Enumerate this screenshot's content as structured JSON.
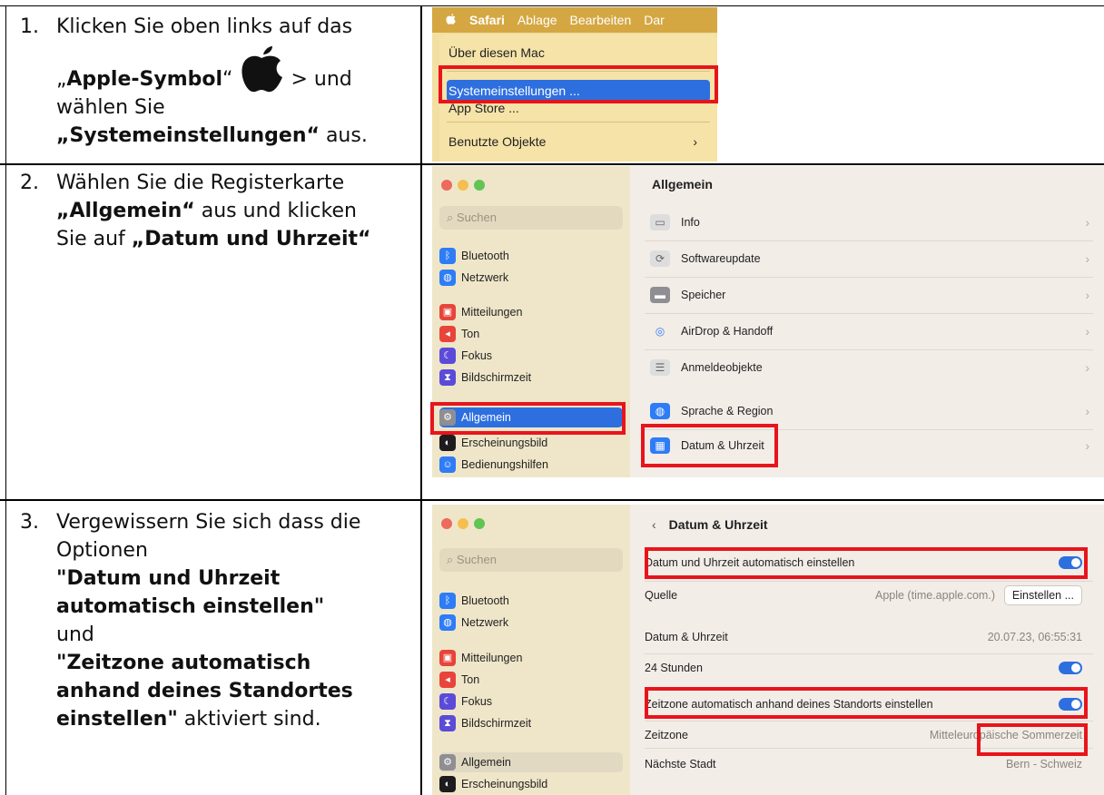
{
  "steps": [
    {
      "num": "1.",
      "line1": "Klicken Sie oben links auf das",
      "quote_open": "„",
      "bold1": "Apple-Symbol",
      "quote_close": "“",
      "after_icon": " > und",
      "line3": "wählen Sie",
      "bold2": "„Systemeinstellungen“",
      "line4_tail": " aus."
    },
    {
      "num": "2.",
      "line1": "Wählen Sie die Registerkarte",
      "bold1": "„Allgemein“",
      "line2_tail": " aus und klicken",
      "line3_head": "Sie auf ",
      "bold2": "„Datum und Uhrzeit“"
    },
    {
      "num": "3.",
      "line1": "Vergewissern Sie sich dass die",
      "line2": "Optionen",
      "bold1a": "\"Datum und Uhrzeit",
      "bold1b": "automatisch einstellen\"",
      "line5": "und",
      "bold2a": "\"Zeitzone automatisch",
      "bold2b": "anhand deines Standortes",
      "bold2c": "einstellen\"",
      "tail": " aktiviert sind."
    }
  ],
  "menu": {
    "bar": {
      "app": "Safari",
      "items": [
        "Ablage",
        "Bearbeiten",
        "Dar"
      ]
    },
    "items": [
      "Über diesen Mac",
      "Systemeinstellungen ...",
      "App Store ...",
      "Benutzte Objekte"
    ],
    "arrow": "›"
  },
  "sidebar": {
    "search_placeholder": "Suchen",
    "items": [
      "Bluetooth",
      "Netzwerk",
      "Mitteilungen",
      "Ton",
      "Fokus",
      "Bildschirmzeit",
      "Allgemein",
      "Erscheinungsbild",
      "Bedienungshilfen"
    ]
  },
  "general": {
    "title": "Allgemein",
    "rows": [
      "Info",
      "Softwareupdate",
      "Speicher",
      "AirDrop & Handoff",
      "Anmeldeobjekte",
      "Sprache & Region",
      "Datum & Uhrzeit"
    ]
  },
  "datetime": {
    "back": "‹",
    "title": "Datum & Uhrzeit",
    "auto_label": "Datum und Uhrzeit automatisch einstellen",
    "source_label": "Quelle",
    "source_value": "Apple (time.apple.com.)",
    "set_button": "Einstellen ...",
    "datetime_label": "Datum & Uhrzeit",
    "datetime_value": "20.07.23, 06:55:31",
    "h24_label": "24 Stunden",
    "tz_auto_label": "Zeitzone automatisch anhand deines Standorts einstellen",
    "tz_label": "Zeitzone",
    "tz_value": "Mitteleuropäische Sommerzeit",
    "city_label": "Nächste Stadt",
    "city_value": "Bern - Schweiz"
  },
  "colors": {
    "highlight": "#e8141c",
    "accent": "#2e6fe0"
  }
}
